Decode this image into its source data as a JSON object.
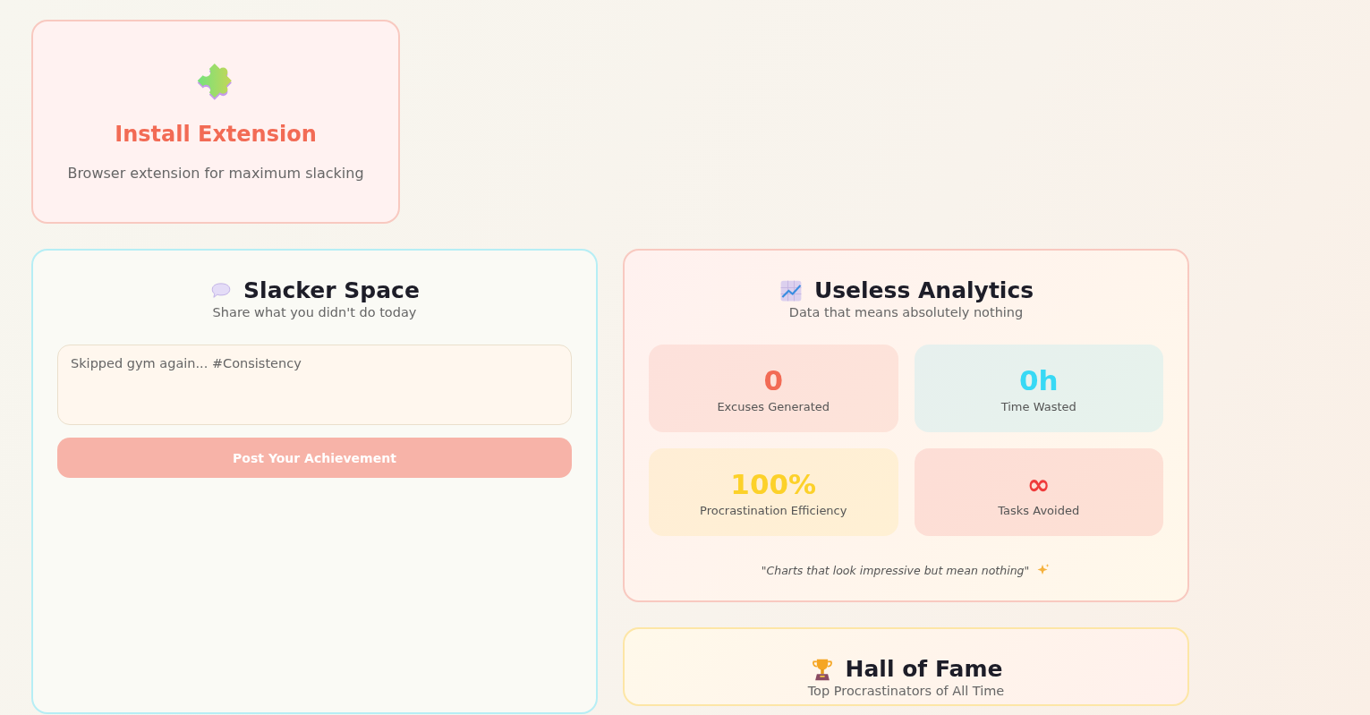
{
  "install_card": {
    "title": "Install Extension",
    "description": "Browser extension for maximum slacking"
  },
  "slacker_space": {
    "title": "Slacker Space",
    "subtitle": "Share what you didn't do today",
    "post_field": {
      "placeholder": "Skipped gym again... #Consistency"
    },
    "post_button": {
      "label": "Post Your Achievement",
      "disabled": true
    }
  },
  "analytics": {
    "title": "Useless Analytics",
    "subtitle": "Data that means absolutely nothing",
    "stats": [
      {
        "value": "0",
        "label": "Excuses Generated",
        "color": "#f26b55"
      },
      {
        "value": "0h",
        "label": "Time Wasted",
        "color": "#38d9f5"
      },
      {
        "value": "100%",
        "label": "Procrastination Efficiency",
        "color": "#fcd12a"
      },
      {
        "value": "∞",
        "label": "Tasks Avoided",
        "color": "#ef3b3b"
      }
    ],
    "footnote": "\"Charts that look impressive but mean nothing\""
  },
  "hall_of_fame": {
    "title": "Hall of Fame",
    "subtitle": "Top Procrastinators of All Time"
  }
}
